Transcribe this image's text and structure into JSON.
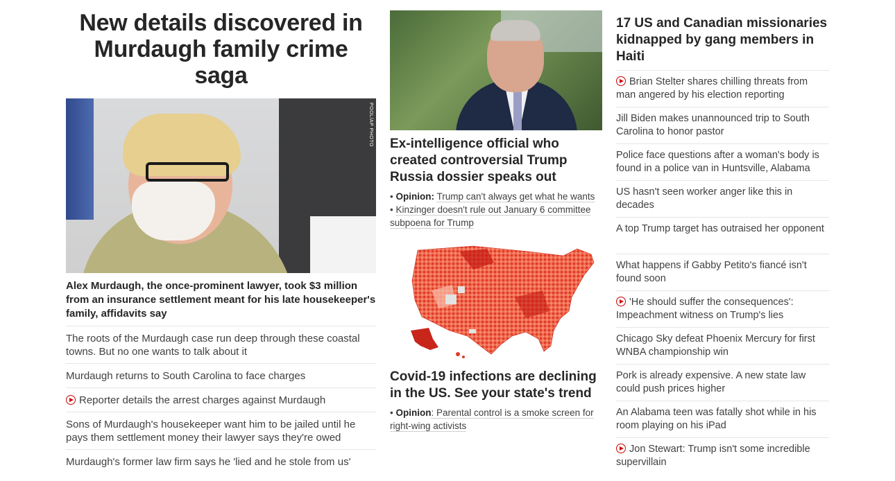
{
  "left": {
    "headline": "New details discovered in Murdaugh family crime saga",
    "image_credit": "POOL/AP PHOTO",
    "lead": "Alex Murdaugh, the once-prominent lawyer, took $3 million from an insurance settlement meant for his late housekeeper's family, affidavits say",
    "items": [
      {
        "text": "The roots of the Murdaugh case run deep through these coastal towns. But no one wants to talk about it",
        "video": false
      },
      {
        "text": "Murdaugh returns to South Carolina to face charges",
        "video": false
      },
      {
        "text": "Reporter details the arrest charges against Murdaugh",
        "video": true
      },
      {
        "text": "Sons of Murdaugh's housekeeper want him to be jailed until he pays them settlement money their lawyer says they're owed",
        "video": false
      },
      {
        "text": "Murdaugh's former law firm says he 'lied and he stole from us'",
        "video": false
      }
    ]
  },
  "middle": {
    "story1": {
      "headline": "Ex-intelligence official who created controversial Trump Russia dossier speaks out",
      "links": [
        {
          "prefix": "Opinion:",
          "text": "Trump can't always get what he wants"
        },
        {
          "prefix": "",
          "text": "Kinzinger doesn't rule out January 6 committee subpoena for Trump"
        }
      ]
    },
    "story2": {
      "headline": "Covid-19 infections are declining in the US. See your state's trend",
      "links": [
        {
          "prefix": "Opinion",
          "text": ": Parental control is a smoke screen for right-wing activists"
        }
      ]
    }
  },
  "right": {
    "headline": "17 US and Canadian missionaries kidnapped by gang members in Haiti",
    "items": [
      {
        "text": "Brian Stelter shares chilling threats from man angered by his election reporting",
        "video": true
      },
      {
        "text": "Jill Biden makes unannounced trip to South Carolina to honor pastor",
        "video": false
      },
      {
        "text": "Police face questions after a woman's body is found in a police van in Huntsville, Alabama",
        "video": false
      },
      {
        "text": "US hasn't seen worker anger like this in decades",
        "video": false
      },
      {
        "text": "A top Trump target has outraised her opponent",
        "video": false
      },
      {
        "text": "What happens if Gabby Petito's fiancé isn't found soon",
        "video": false
      },
      {
        "text": "'He should suffer the consequences': Impeachment witness on Trump's lies",
        "video": true
      },
      {
        "text": "Chicago Sky defeat Phoenix Mercury for first WNBA championship win",
        "video": false
      },
      {
        "text": "Pork is already expensive. A new state law could push prices higher",
        "video": false
      },
      {
        "text": "An Alabama teen was fatally shot while in his room playing on his iPad",
        "video": false
      },
      {
        "text": "Jon Stewart: Trump isn't some incredible supervillain",
        "video": true
      }
    ]
  },
  "colors": {
    "video_icon": "#cc0000",
    "text": "#262626",
    "secondary_text": "#404040",
    "divider": "#e6e6e6"
  }
}
